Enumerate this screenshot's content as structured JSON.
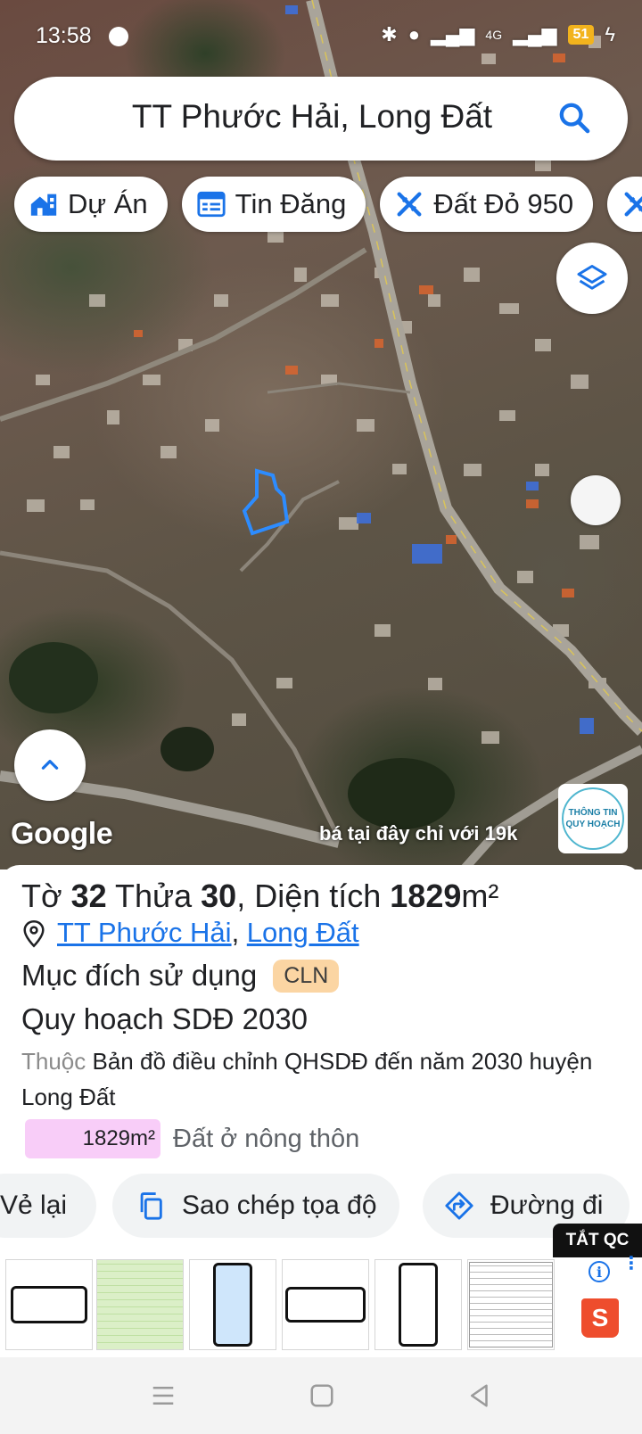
{
  "status_bar": {
    "time": "13:58",
    "network_label": "4G",
    "battery": "51"
  },
  "search": {
    "query": "TT Phước Hải, Long Đất"
  },
  "chips": [
    {
      "label": "Dự Án",
      "icon": "home-city-icon"
    },
    {
      "label": "Tin Đăng",
      "icon": "calendar-list-icon"
    },
    {
      "label": "Đất Đỏ 950",
      "icon": "ruler-compass-icon"
    },
    {
      "label": "",
      "icon": "ruler-compass-icon"
    }
  ],
  "map": {
    "provider_logo": "Google",
    "ad_overlay_text": "bá tại đây chỉ với 19k",
    "info_badge_text": "THÔNG TIN QUY HOẠCH",
    "parcel_outline_color": "#2d8cff"
  },
  "parcel": {
    "title_prefix": "Tờ ",
    "sheet_no": "32",
    "parcel_label": " Thửa ",
    "parcel_no": "30",
    "area_label": ", Diện tích ",
    "area_value": "1829",
    "area_unit": "m²",
    "location_ward": "TT Phước Hải",
    "location_sep": ", ",
    "location_district": "Long Đất",
    "purpose_label": "Mục đích sử dụng",
    "purpose_code": "CLN",
    "plan_title": "Quy hoạch SDĐ 2030",
    "desc_muted": "Thuộc ",
    "desc_text": "Bản đồ điều chỉnh QHSDĐ đến năm 2030 huyện Long Đất",
    "zone_area": "1829m²",
    "zone_type": "Đất ở nông thôn",
    "zone_color": "#f8cdf8"
  },
  "actions": [
    {
      "label": "Vẻ lại"
    },
    {
      "label": "Sao chép tọa độ",
      "icon": "copy-icon"
    },
    {
      "label": "Đường đi",
      "icon": "directions-icon"
    }
  ],
  "ad": {
    "close_label": "TẮT QC",
    "brand_icon": "shopee-bag-icon",
    "brand_letter": "S"
  },
  "colors": {
    "accent": "#1a73e8",
    "cln_badge": "#fbd5a3"
  }
}
